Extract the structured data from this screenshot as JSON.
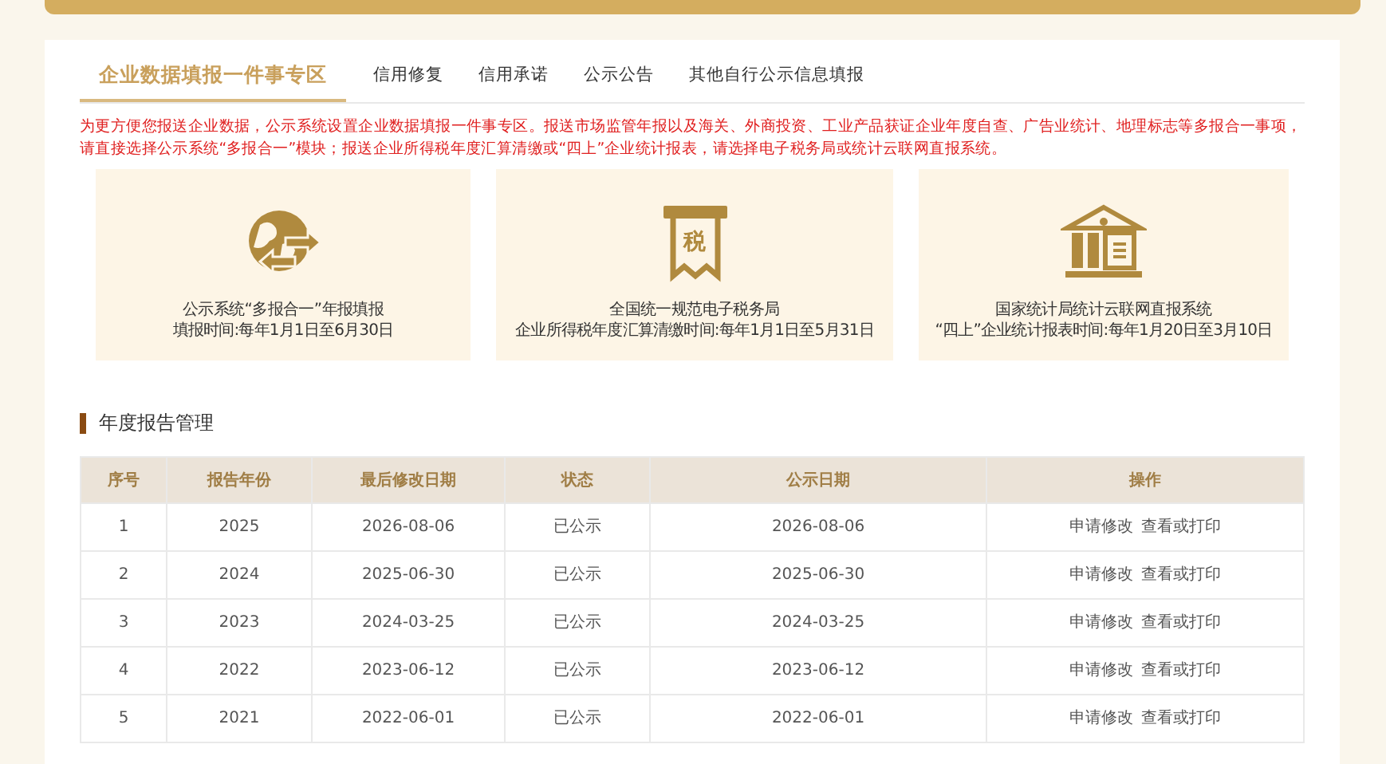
{
  "tabs": [
    {
      "label": "企业数据填报一件事专区",
      "selected": true
    },
    {
      "label": "信用修复",
      "selected": false
    },
    {
      "label": "信用承诺",
      "selected": false
    },
    {
      "label": "公示公告",
      "selected": false
    },
    {
      "label": "其他自行公示信息填报",
      "selected": false
    }
  ],
  "notice": "为更方便您报送企业数据，公示系统设置企业数据填报一件事专区。报送市场监管年报以及海关、外商投资、工业产品获证企业年度自查、广告业统计、地理标志等多报合一事项，请直接选择公示系统“多报合一”模块；报送企业所得税年度汇算清缴或“四上”企业统计报表，请选择电子税务局或统计云联网直报系统。",
  "cards": [
    {
      "kind": "globe",
      "title": "公示系统“多报合一”年报填报",
      "subtitle": "填报时间:每年1月1日至6月30日"
    },
    {
      "kind": "tax",
      "icon_text": "税",
      "title": "全国统一规范电子税务局",
      "subtitle": "企业所得税年度汇算清缴时间:每年1月1日至5月31日"
    },
    {
      "kind": "bureau",
      "title": "国家统计局统计云联网直报系统",
      "subtitle": "“四上”企业统计报表时间:每年1月20日至3月10日"
    }
  ],
  "section_title": "年度报告管理",
  "table": {
    "columns": [
      "序号",
      "报告年份",
      "最后修改日期",
      "状态",
      "公示日期",
      "操作"
    ],
    "rows": [
      {
        "cells": [
          "1",
          "2025",
          "2026-08-06",
          "已公示",
          "2026-08-06"
        ],
        "actions": [
          "申请修改",
          "查看或打印"
        ]
      },
      {
        "cells": [
          "2",
          "2024",
          "2025-06-30",
          "已公示",
          "2025-06-30"
        ],
        "actions": [
          "申请修改",
          "查看或打印"
        ]
      },
      {
        "cells": [
          "3",
          "2023",
          "2024-03-25",
          "已公示",
          "2024-03-25"
        ],
        "actions": [
          "申请修改",
          "查看或打印"
        ]
      },
      {
        "cells": [
          "4",
          "2022",
          "2023-06-12",
          "已公示",
          "2023-06-12"
        ],
        "actions": [
          "申请修改",
          "查看或打印"
        ]
      },
      {
        "cells": [
          "5",
          "2021",
          "2022-06-01",
          "已公示",
          "2022-06-01"
        ],
        "actions": [
          "申请修改",
          "查看或打印"
        ]
      }
    ]
  }
}
